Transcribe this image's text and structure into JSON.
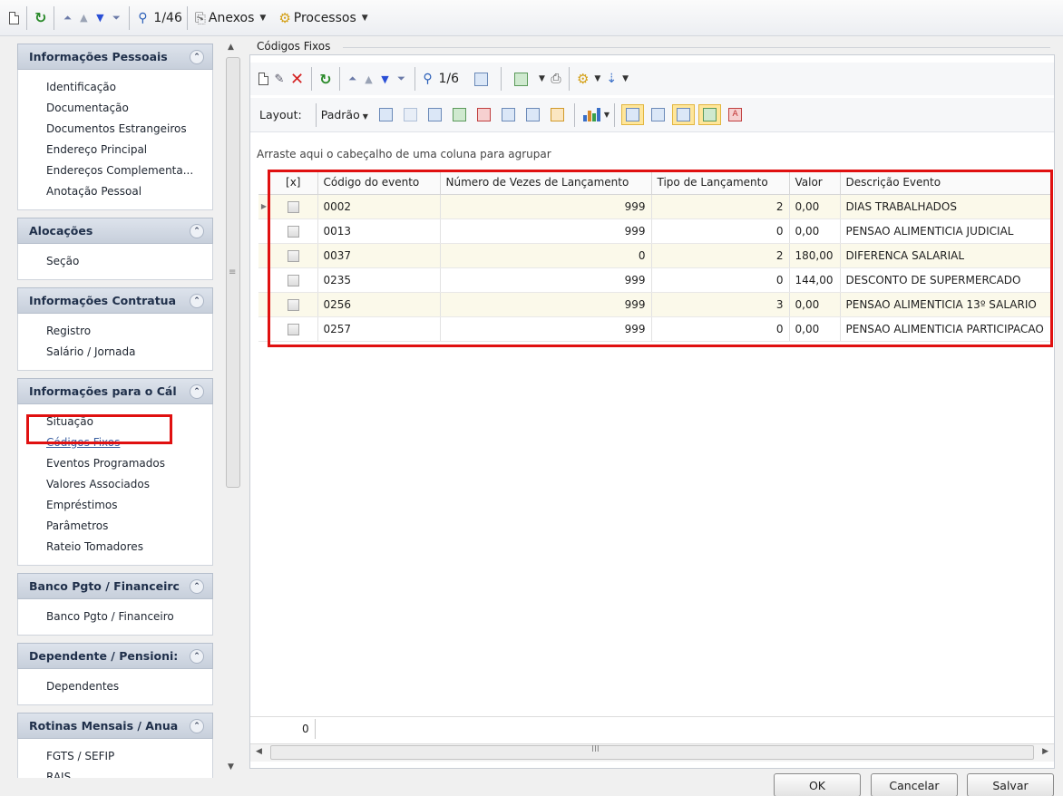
{
  "top_toolbar": {
    "record_counter": "1/46",
    "attachments_label": "Anexos",
    "processes_label": "Processos"
  },
  "left_panel": {
    "groups": [
      {
        "title": "Informações Pessoais",
        "items": [
          "Identificação",
          "Documentação",
          "Documentos Estrangeiros",
          "Endereço Principal",
          "Endereços Complementa...",
          "Anotação Pessoal"
        ]
      },
      {
        "title": "Alocações",
        "items": [
          "Seção"
        ]
      },
      {
        "title": "Informações Contratua",
        "items": [
          "Registro",
          "Salário / Jornada"
        ]
      },
      {
        "title": "Informações para o Cál",
        "items": [
          "Situação",
          "Códigos Fixos",
          "Eventos Programados",
          "Valores Associados",
          "Empréstimos",
          "Parâmetros",
          "Rateio Tomadores"
        ]
      },
      {
        "title": "Banco Pgto / Financeirc",
        "items": [
          "Banco Pgto / Financeiro"
        ]
      },
      {
        "title": "Dependente / Pensioni:",
        "items": [
          "Dependentes"
        ]
      },
      {
        "title": "Rotinas Mensais / Anua",
        "items": [
          "FGTS / SEFIP",
          "RAIS"
        ]
      }
    ],
    "selected_item": "Códigos Fixos"
  },
  "section": {
    "title": "Códigos Fixos"
  },
  "grid_toolbar": {
    "record_counter": "1/6"
  },
  "layout_bar": {
    "layout_label": "Layout:",
    "layout_value": "Padrão"
  },
  "grid": {
    "group_hint": "Arraste aqui o cabeçalho de uma coluna para agrupar",
    "columns": [
      "[x]",
      "Código do evento",
      "Número de Vezes de Lançamento",
      "Tipo de Lançamento",
      "Valor",
      "Descrição Evento"
    ],
    "rows": [
      {
        "codigo": "0002",
        "vezes": "999",
        "tipo": "2",
        "valor": "0,00",
        "descricao": "DIAS TRABALHADOS"
      },
      {
        "codigo": "0013",
        "vezes": "999",
        "tipo": "0",
        "valor": "0,00",
        "descricao": "PENSAO ALIMENTICIA JUDICIAL"
      },
      {
        "codigo": "0037",
        "vezes": "0",
        "tipo": "2",
        "valor": "180,00",
        "descricao": "DIFERENCA SALARIAL"
      },
      {
        "codigo": "0235",
        "vezes": "999",
        "tipo": "0",
        "valor": "144,00",
        "descricao": "DESCONTO DE SUPERMERCADO"
      },
      {
        "codigo": "0256",
        "vezes": "999",
        "tipo": "3",
        "valor": "0,00",
        "descricao": "PENSAO ALIMENTICIA 13º SALARIO"
      },
      {
        "codigo": "0257",
        "vezes": "999",
        "tipo": "0",
        "valor": "0,00",
        "descricao": "PENSAO ALIMENTICIA PARTICIPACAO"
      }
    ],
    "footer_count": "0"
  },
  "dialog_buttons": {
    "ok": "OK",
    "cancel": "Cancelar",
    "save": "Salvar"
  },
  "colors": {
    "highlight_red": "#e01010",
    "group_header": "#c7cfdb",
    "alt_row": "#fbf9ea"
  }
}
